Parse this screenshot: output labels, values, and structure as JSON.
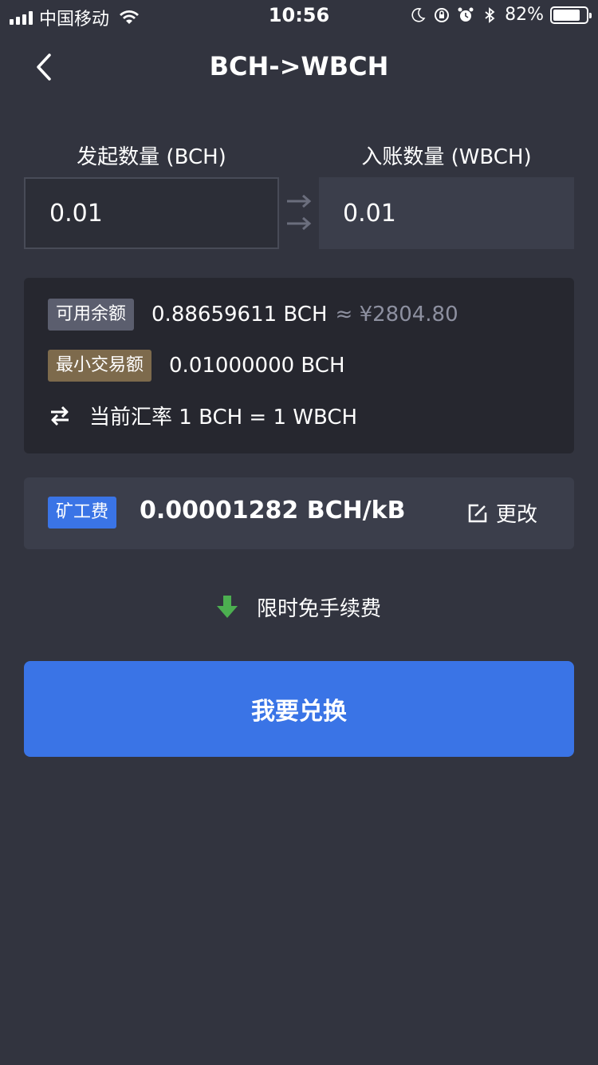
{
  "status_bar": {
    "carrier": "中国移动",
    "time": "10:56",
    "battery": "82%",
    "battery_level": 0.82
  },
  "nav": {
    "title": "BCH->WBCH"
  },
  "exchange": {
    "from_label": "发起数量 (BCH)",
    "to_label": "入账数量 (WBCH)",
    "from_value": "0.01",
    "to_value": "0.01"
  },
  "info": {
    "balance_tag": "可用余额",
    "balance_value": "0.88659611 BCH",
    "balance_approx": "≈ ¥2804.80",
    "min_tag": "最小交易额",
    "min_value": "0.01000000 BCH",
    "rate_text": "当前汇率 1 BCH = 1 WBCH"
  },
  "fee": {
    "tag": "矿工费",
    "value": "0.00001282 BCH/kB",
    "edit_label": "更改"
  },
  "promo": {
    "text": "限时免手续费"
  },
  "submit": {
    "label": "我要兑换"
  },
  "colors": {
    "background": "#32343f",
    "primary": "#3a74e6",
    "card": "#26272f",
    "promo_icon": "#4caf50",
    "tag_gold": "#7d6a4c",
    "tag_gray": "#5b5e6e"
  }
}
